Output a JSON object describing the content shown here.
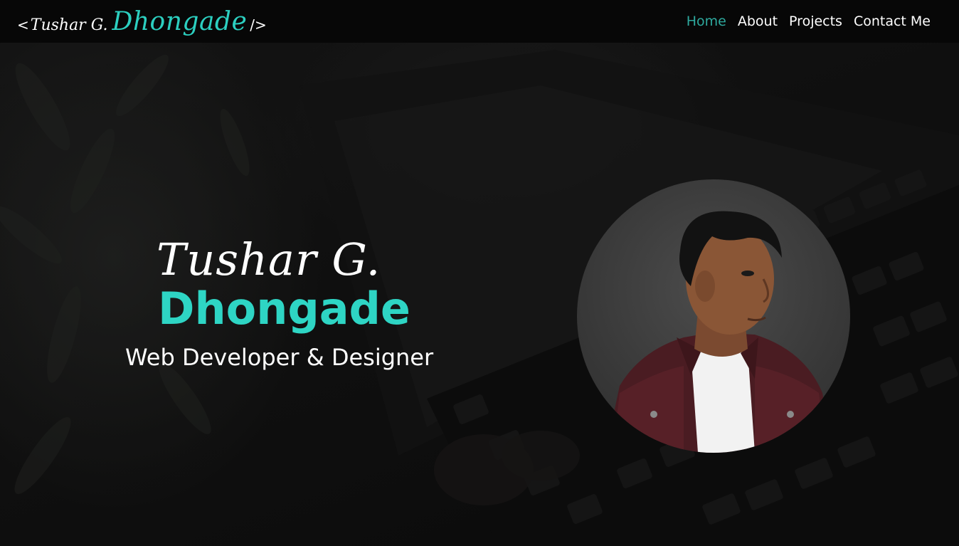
{
  "brand": {
    "open_bracket": "<",
    "first_name": "Tushar G.",
    "last_name": "Dhongade",
    "close_bracket": "/>"
  },
  "nav": {
    "items": [
      {
        "label": "Home",
        "active": true
      },
      {
        "label": "About",
        "active": false
      },
      {
        "label": "Projects",
        "active": false
      },
      {
        "label": "Contact Me",
        "active": false
      }
    ]
  },
  "hero": {
    "first_name": "Tushar G.",
    "last_name": "Dhongade",
    "role": "Web Developer & Designer"
  },
  "colors": {
    "accent": "#2ed5c4",
    "nav_active": "#2ea99e",
    "navbar_bg": "#070707"
  }
}
